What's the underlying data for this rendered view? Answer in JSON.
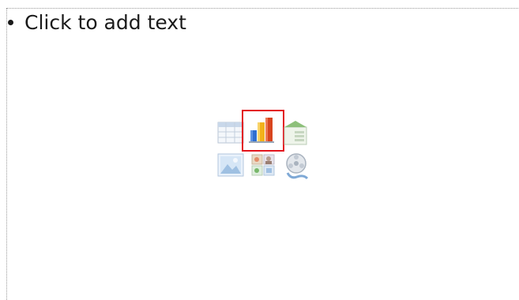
{
  "placeholder": {
    "prompt_text": "Click to add text"
  },
  "content_icons": [
    {
      "name": "insert-table",
      "icon": "table-icon"
    },
    {
      "name": "insert-chart",
      "icon": "chart-icon",
      "highlighted": true,
      "highlight_color": "#e3141c"
    },
    {
      "name": "insert-smartart",
      "icon": "smartart-icon"
    },
    {
      "name": "insert-picture",
      "icon": "picture-icon"
    },
    {
      "name": "insert-clipart",
      "icon": "clipart-icon"
    },
    {
      "name": "insert-media",
      "icon": "media-clip-icon"
    }
  ]
}
